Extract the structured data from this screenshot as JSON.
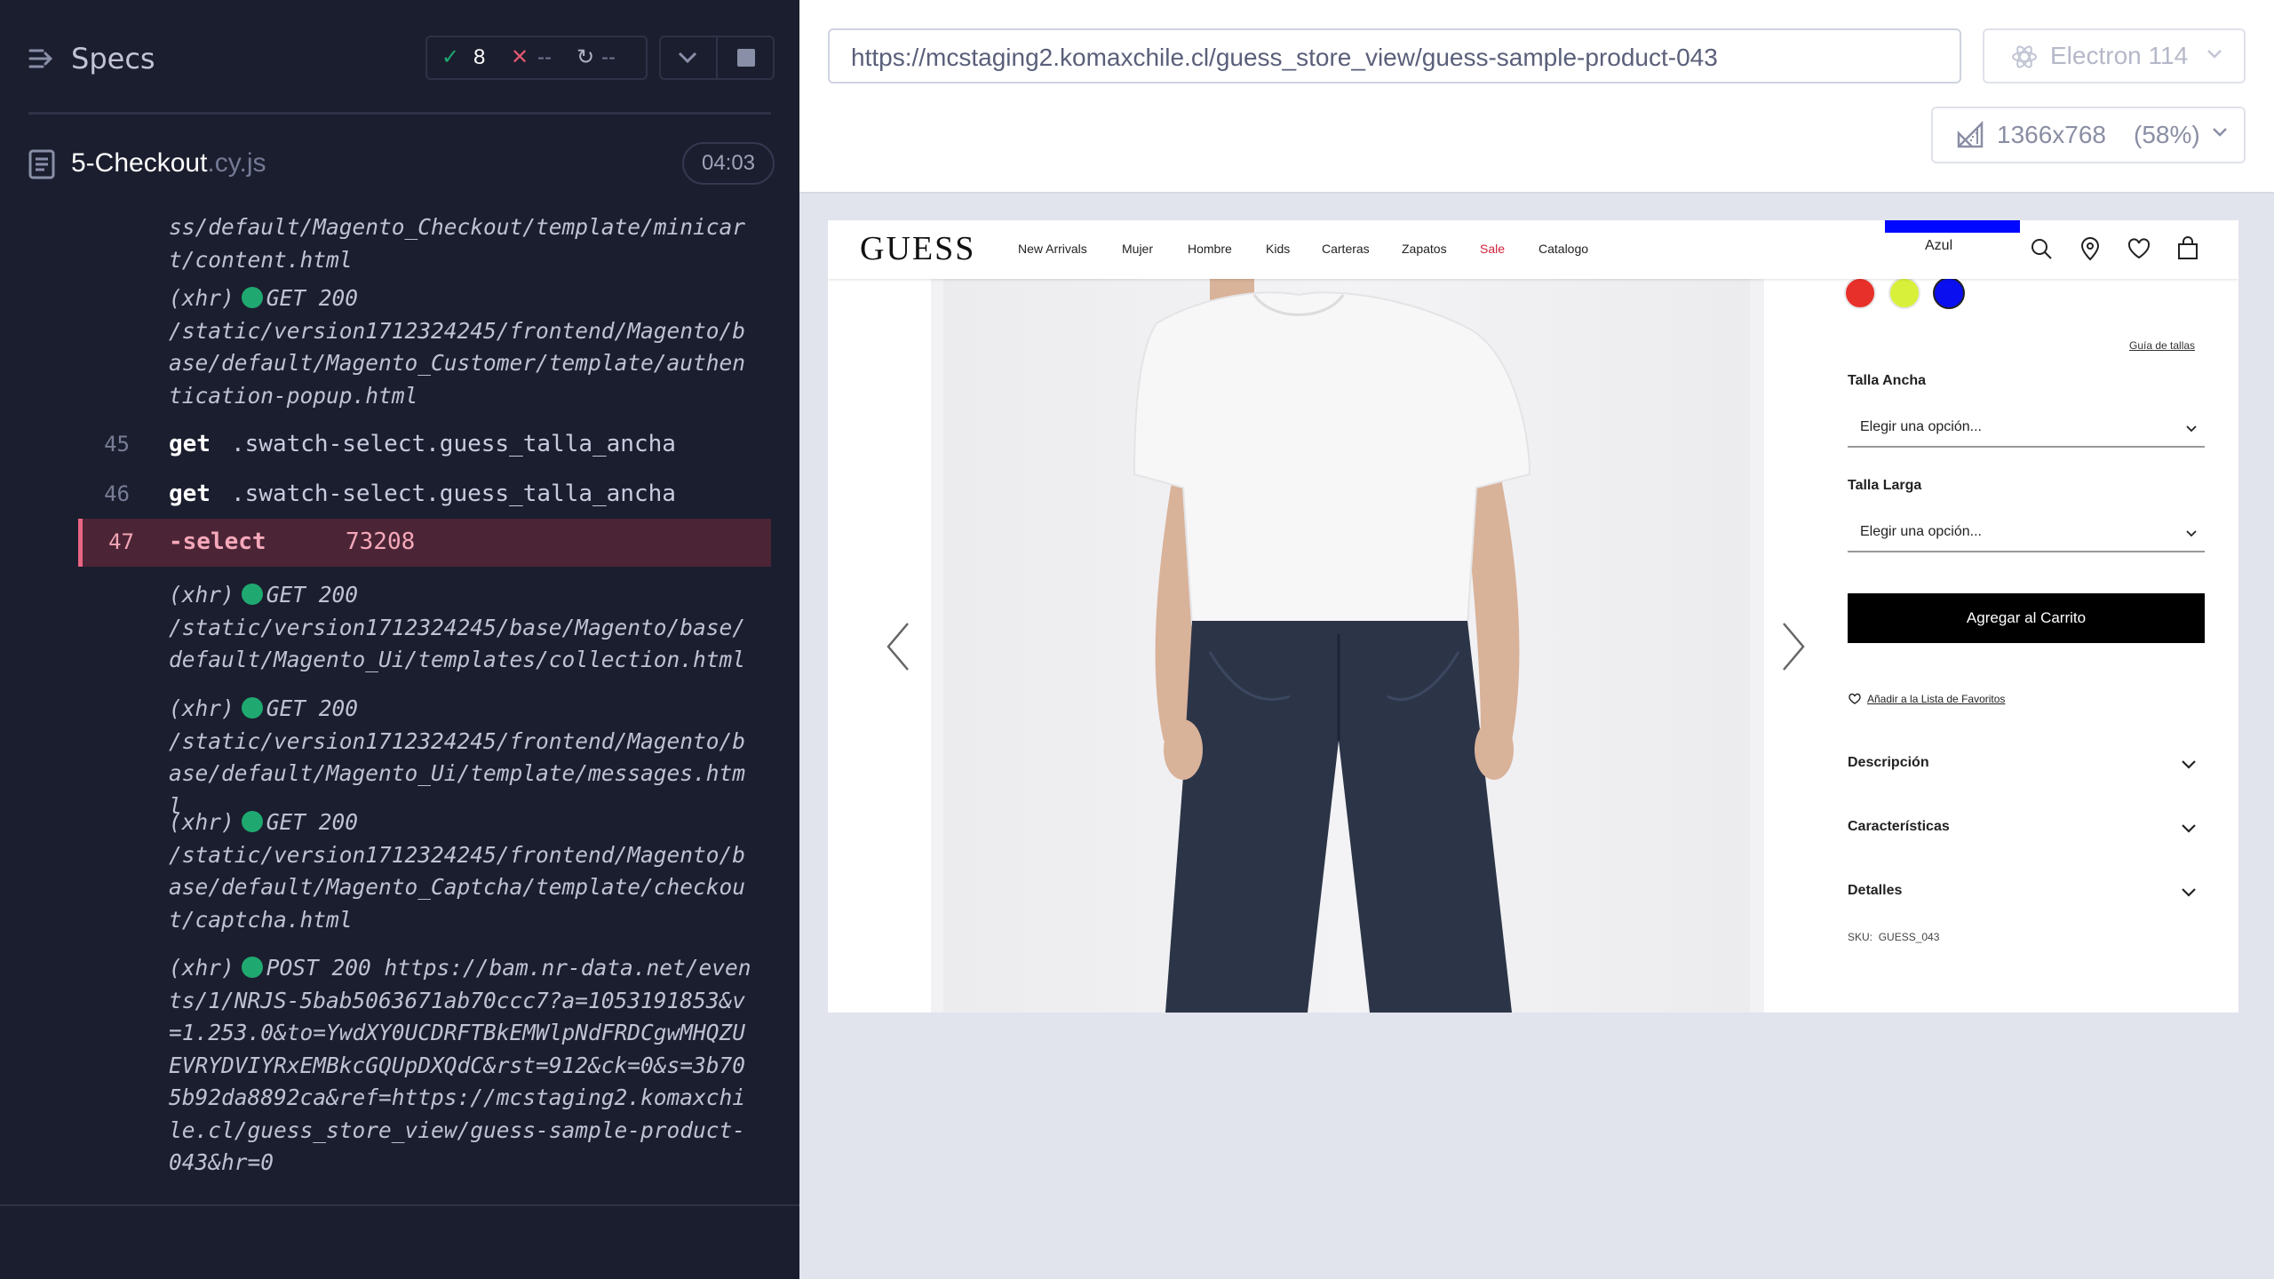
{
  "reporter": {
    "title": "Specs",
    "stats": {
      "passed": "8",
      "failed": "--",
      "pending": "--"
    },
    "file": {
      "name": "5-Checkout",
      "ext": ".cy.js",
      "duration": "04:03"
    },
    "log": {
      "xhr1": "ss/default/Magento_Checkout/template/minicart/content.html",
      "xhr2_prefix": "(xhr)",
      "xhr2_method": "GET 200",
      "xhr2_url": "/static/version1712324245/frontend/Magento/base/default/Magento_Customer/template/authentication-popup.html",
      "cmd45": {
        "num": "45",
        "name": "get",
        "msg": ".swatch-select.guess_talla_ancha"
      },
      "cmd46": {
        "num": "46",
        "name": "get",
        "msg": ".swatch-select.guess_talla_ancha"
      },
      "cmd47": {
        "num": "47",
        "name": "-select",
        "msg": "73208"
      },
      "xhr3_prefix": "(xhr)",
      "xhr3_method": "GET 200",
      "xhr3_url": "/static/version1712324245/base/Magento/base/default/Magento_Ui/templates/collection.html",
      "xhr4_prefix": "(xhr)",
      "xhr4_method": "GET 200",
      "xhr4_url": "/static/version1712324245/frontend/Magento/base/default/Magento_Ui/template/messages.html",
      "xhr5_prefix": "(xhr)",
      "xhr5_method": "GET 200",
      "xhr5_url": "/static/version1712324245/frontend/Magento/base/default/Magento_Captcha/template/checkout/captcha.html",
      "xhr6_prefix": "(xhr)",
      "xhr6_method": "POST 200",
      "xhr6_url": "https://bam.nr-data.net/events/1/NRJS-5bab5063671ab70ccc7?a=1053191853&v=1.253.0&to=YwdXY0UCDRFTBkEMWlpNdFRDCgwMHQZUEVRYDVIYRxEMBkcGQUpDXQdC&rst=912&ck=0&s=3b705b92da8892ca&ref=https://mcstaging2.komaxchile.cl/guess_store_view/guess-sample-product-043&hr=0"
    }
  },
  "aut": {
    "url": "https://mcstaging2.komaxchile.cl/guess_store_view/guess-sample-product-043",
    "browser": "Electron 114",
    "viewport": "1366x768",
    "scale": "(58%)"
  },
  "site": {
    "logo": "GUESS",
    "nav": [
      "New Arrivals",
      "Mujer",
      "Hombre",
      "Kids",
      "Carteras",
      "Zapatos",
      "Sale",
      "Catalogo"
    ],
    "color_tooltip": "Azul",
    "swatches": [
      "#e8302a",
      "#d9f03a",
      "#0a0ff0"
    ],
    "size_guide": "Guía de tallas",
    "talla_ancha_label": "Talla Ancha",
    "talla_ancha_value": "Elegir una opción...",
    "talla_larga_label": "Talla Larga",
    "talla_larga_value": "Elegir una opción...",
    "add_to_cart": "Agregar al Carrito",
    "wishlist": "Añadir a la Lista de Favoritos",
    "accordions": [
      "Descripción",
      "Características",
      "Detalles"
    ],
    "sku_label": "SKU:",
    "sku_value": "GUESS_043"
  }
}
